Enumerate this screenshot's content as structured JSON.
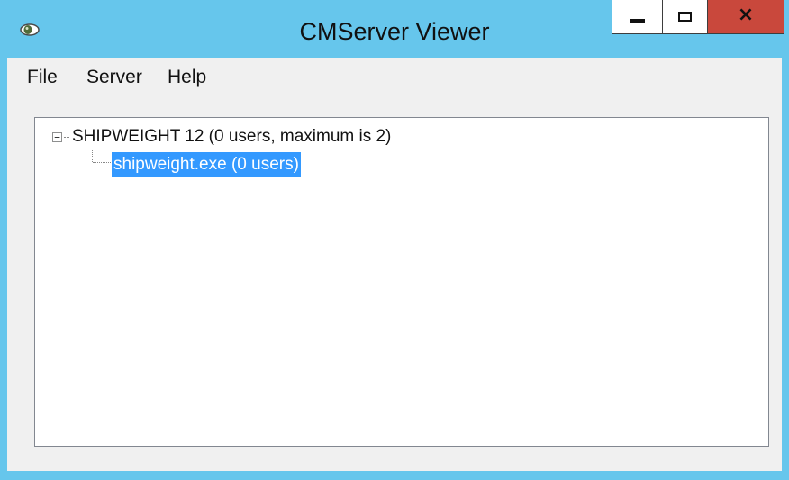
{
  "window": {
    "title": "CMServer Viewer",
    "controls": {
      "minimize": "minimize-icon",
      "maximize": "maximize-icon",
      "close": "×"
    }
  },
  "menubar": {
    "file": "File",
    "server": "Server",
    "help": "Help"
  },
  "tree": {
    "root": {
      "label": "SHIPWEIGHT 12 (0 users, maximum is 2)",
      "expander": "−",
      "expanded": true
    },
    "children": [
      {
        "label": "shipweight.exe (0 users)",
        "selected": true
      }
    ]
  },
  "colors": {
    "frame": "#66c6ec",
    "close_button": "#c9483c",
    "selection": "#3399ff"
  }
}
